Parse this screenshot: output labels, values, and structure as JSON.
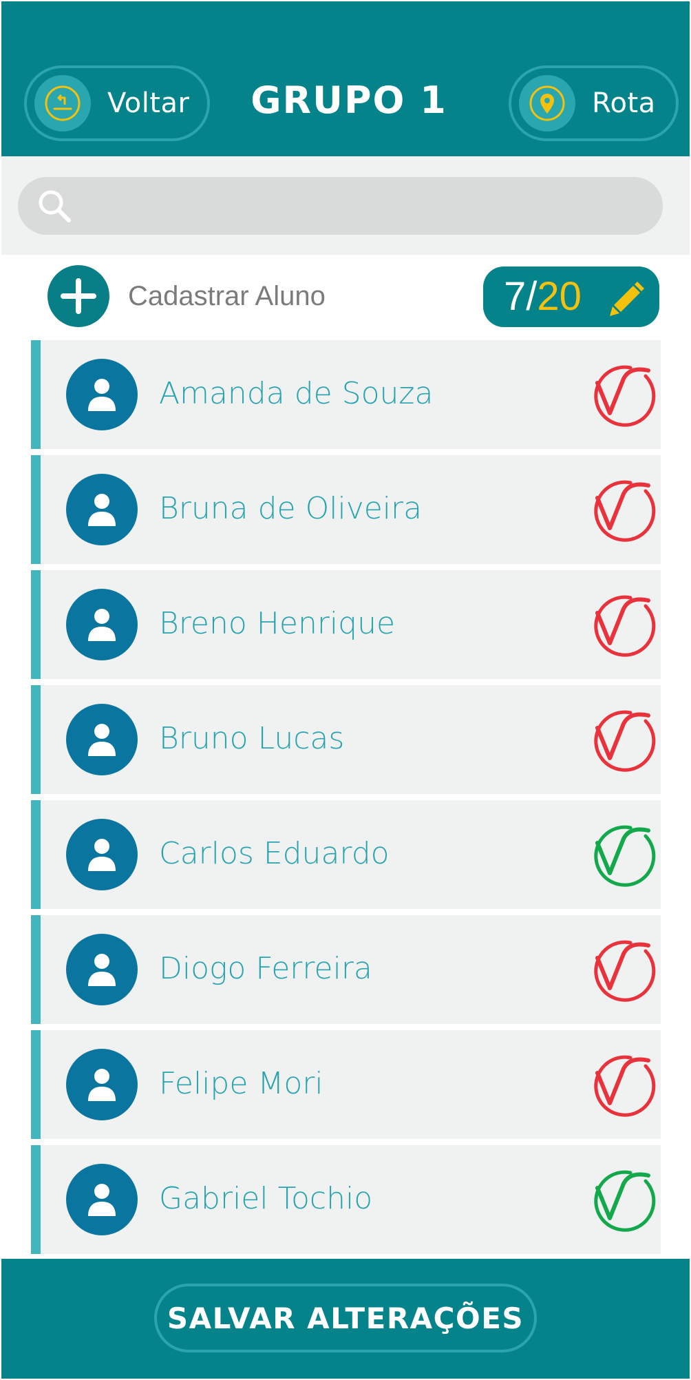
{
  "header": {
    "title": "GRUPO 1",
    "back_label": "Voltar",
    "route_label": "Rota",
    "back_icon": "return-arrow-icon",
    "route_icon": "map-pin-icon"
  },
  "search": {
    "placeholder": "",
    "icon": "search-icon"
  },
  "register": {
    "label": "Cadastrar Aluno",
    "icon": "plus-icon"
  },
  "counter": {
    "current": "7",
    "separator": "/",
    "total": "20",
    "icon": "pencil-icon"
  },
  "colors": {
    "brand": "#05838b",
    "accent_yellow": "#f4c20d",
    "absent_red": "#e8333c",
    "present_green": "#12a84b",
    "name_text": "#29a3ae"
  },
  "students": [
    {
      "name": "Amanda de Souza",
      "status": "absent"
    },
    {
      "name": "Bruna de Oliveira",
      "status": "absent"
    },
    {
      "name": "Breno Henrique",
      "status": "absent"
    },
    {
      "name": "Bruno Lucas",
      "status": "absent"
    },
    {
      "name": "Carlos Eduardo",
      "status": "present"
    },
    {
      "name": "Diogo Ferreira",
      "status": "absent"
    },
    {
      "name": "Felipe Mori",
      "status": "absent"
    },
    {
      "name": "Gabriel Tochio",
      "status": "present"
    }
  ],
  "footer": {
    "save_label": "SALVAR ALTERAÇÕES"
  }
}
